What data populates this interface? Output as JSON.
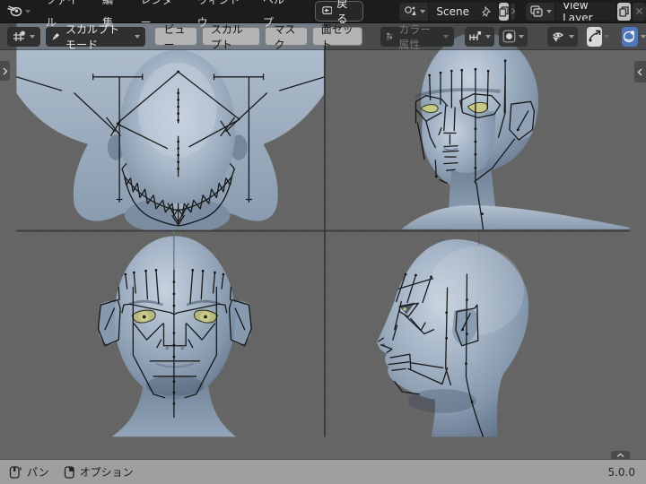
{
  "topbar": {
    "menus": [
      "ファイル",
      "編集",
      "レンダー",
      "ウィンドウ",
      "ヘルプ"
    ],
    "back_label": "戻る",
    "scene": {
      "value": "Scene"
    },
    "view_layer": {
      "value": "View Layer"
    }
  },
  "header": {
    "mode_label": "スカルプトモード",
    "menus": [
      "ビュー",
      "スカルプト",
      "マスク",
      "面セット"
    ],
    "color_attribute_label": "カラー属性"
  },
  "statusbar": {
    "pan_label": "パン",
    "options_label": "オプション",
    "version": "5.0.0"
  },
  "icons": {
    "logo": "blender-logo",
    "back": "monitor-back-arrow",
    "scene": "scene-icon",
    "pin": "pin-icon",
    "duplicate": "new-copy-icon",
    "unlink": "x-icon",
    "view_layer": "layers-icon",
    "editor_type": "3d-viewport-icon",
    "mode": "brush-icon",
    "color_attribute": "vertex-color-icon",
    "snap": "snap-increment-icon",
    "falloff": "falloff-circle-icon",
    "visibility": "object-visibility-icon",
    "gizmo": "gizmo-icon",
    "shading": "viewport-shading-icon",
    "pan_mouse": "mouse-middle-drag-icon",
    "options_mouse": "mouse-right-icon"
  },
  "colors": {
    "topbar_bg": "#1c1c1c",
    "header_overlay": "rgba(40,42,45,0.45)",
    "viewport_bg": "#656565",
    "statusbar_bg": "#9f9fa0",
    "accent_blue": "#4f76b8",
    "button_light": "#b4b4b4",
    "matcap_base": "#a6b6c8",
    "eye_color": "#c6c886",
    "annotation": "#101010"
  }
}
